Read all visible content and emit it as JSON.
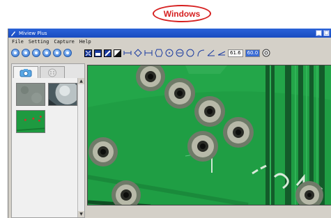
{
  "os_label": "Windows",
  "window": {
    "title": "Miview Plus"
  },
  "menu": [
    "File",
    "Setting",
    "Capture",
    "Help"
  ],
  "toolbar": {
    "round_icons": [
      "snapshot-icon",
      "folder-icon",
      "record-icon",
      "settings-icon",
      "color-icon",
      "print-icon"
    ],
    "view_icons": [
      "fit-icon",
      "contrast-icon",
      "grid-icon",
      "invert-icon"
    ],
    "measure_tools": [
      "line-tool",
      "angle-tool",
      "parallel-tool",
      "polygon-tool",
      "circle-center-tool",
      "circle-3pt-tool",
      "circle-tool",
      "arc-tool",
      "angle-measure-tool",
      "angle-2-tool"
    ],
    "value1": "61.6",
    "value2": "60.0"
  },
  "sidebar": {
    "tabs": [
      "camera-tab",
      "gallery-tab"
    ]
  },
  "colors": {
    "title_bar": "#1a4cc0",
    "pcb_green": "#1f9e44",
    "label_red": "#d62020"
  }
}
